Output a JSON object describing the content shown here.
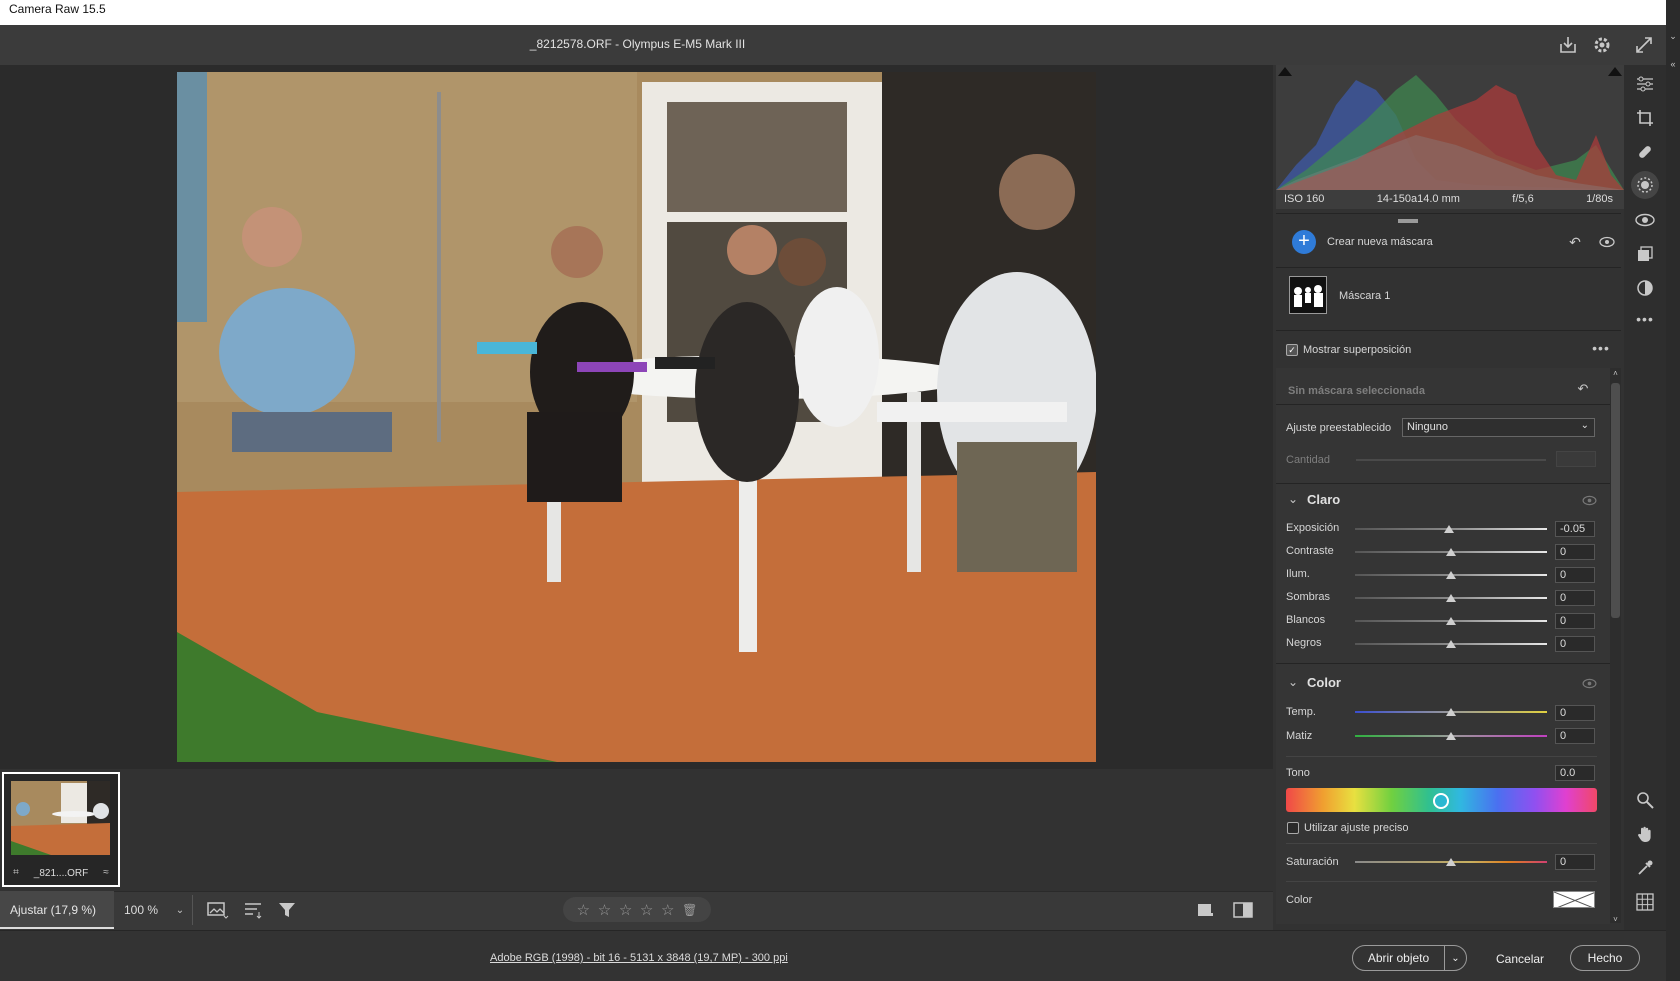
{
  "window": {
    "title": "Camera Raw 15.5"
  },
  "header": {
    "document_title": "_8212578.ORF -  Olympus E-M5 Mark III",
    "icons": [
      "save-icon",
      "gear-icon",
      "fullscreen-icon"
    ]
  },
  "filmstrip": {
    "file_name": "_821....ORF"
  },
  "bottom_bar": {
    "fit_label": "Ajustar (17,9 %)",
    "zoom_label": "100 %",
    "rating_stars": 0
  },
  "status_bar": {
    "workflow_link": "Adobe RGB (1998) - bit 16 - 5131 x 3848 (19,7 MP) - 300 ppi",
    "open_label": "Abrir objeto",
    "cancel_label": "Cancelar",
    "done_label": "Hecho"
  },
  "histogram_meta": {
    "iso": "ISO 160",
    "lens": "14-150a14.0 mm",
    "aperture": "f/5,6",
    "shutter": "1/80s"
  },
  "masks": {
    "create_label": "Crear nueva máscara",
    "mask_name": "Máscara 1",
    "show_overlay_label": "Mostrar superposición",
    "show_overlay_checked": true,
    "no_mask_label": "Sin máscara seleccionada",
    "preset_label": "Ajuste preestablecido",
    "preset_value": "Ninguno",
    "amount_label": "Cantidad"
  },
  "light": {
    "title": "Claro",
    "sliders": [
      {
        "label": "Exposición",
        "value": "-0.05",
        "level": 0.49
      },
      {
        "label": "Contraste",
        "value": "0",
        "level": 0.5
      },
      {
        "label": "Ilum.",
        "value": "0",
        "level": 0.5
      },
      {
        "label": "Sombras",
        "value": "0",
        "level": 0.5
      },
      {
        "label": "Blancos",
        "value": "0",
        "level": 0.5
      },
      {
        "label": "Negros",
        "value": "0",
        "level": 0.5
      }
    ]
  },
  "color": {
    "title": "Color",
    "temp": {
      "label": "Temp.",
      "value": "0",
      "level": 0.5
    },
    "tint": {
      "label": "Matiz",
      "value": "0",
      "level": 0.5
    },
    "hue_label": "Tono",
    "hue_value": "0.0",
    "fine_adjust_label": "Utilizar ajuste preciso",
    "fine_adjust_checked": false,
    "saturation": {
      "label": "Saturación",
      "value": "0",
      "level": 0.5
    },
    "color_label": "Color"
  },
  "colors": {
    "accent": "#2f7bd8",
    "panel": "#323232",
    "canvas": "#2b2b2b"
  }
}
